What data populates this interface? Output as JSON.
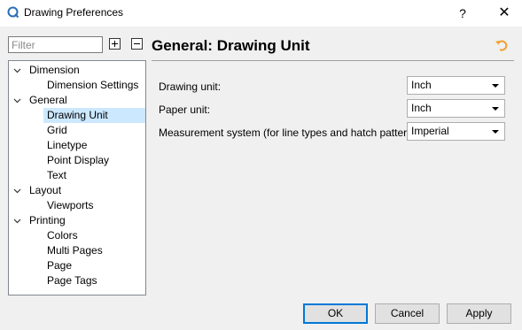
{
  "window": {
    "title": "Drawing Preferences",
    "help_label": "?",
    "close_label": "✕"
  },
  "filter": {
    "placeholder": "Filter",
    "value": ""
  },
  "tree": {
    "items": [
      {
        "label": "Dimension",
        "level": 0,
        "expanded": true
      },
      {
        "label": "Dimension Settings",
        "level": 1
      },
      {
        "label": "General",
        "level": 0,
        "expanded": true
      },
      {
        "label": "Drawing Unit",
        "level": 1,
        "selected": true
      },
      {
        "label": "Grid",
        "level": 1
      },
      {
        "label": "Linetype",
        "level": 1
      },
      {
        "label": "Point Display",
        "level": 1
      },
      {
        "label": "Text",
        "level": 1
      },
      {
        "label": "Layout",
        "level": 0,
        "expanded": true
      },
      {
        "label": "Viewports",
        "level": 1
      },
      {
        "label": "Printing",
        "level": 0,
        "expanded": true
      },
      {
        "label": "Colors",
        "level": 1
      },
      {
        "label": "Multi Pages",
        "level": 1
      },
      {
        "label": "Page",
        "level": 1
      },
      {
        "label": "Page Tags",
        "level": 1
      }
    ]
  },
  "page": {
    "title": "General: Drawing Unit",
    "fields": {
      "drawing_unit": {
        "label": "Drawing unit:",
        "value": "Inch"
      },
      "paper_unit": {
        "label": "Paper unit:",
        "value": "Inch"
      },
      "measurement_system": {
        "label": "Measurement system (for line types and hatch patterns):",
        "value": "Imperial"
      }
    }
  },
  "buttons": {
    "ok": "OK",
    "cancel": "Cancel",
    "apply": "Apply"
  },
  "colors": {
    "selection": "#cce8ff",
    "default_button_border": "#0078d7",
    "reset_icon": "#f0a030"
  }
}
